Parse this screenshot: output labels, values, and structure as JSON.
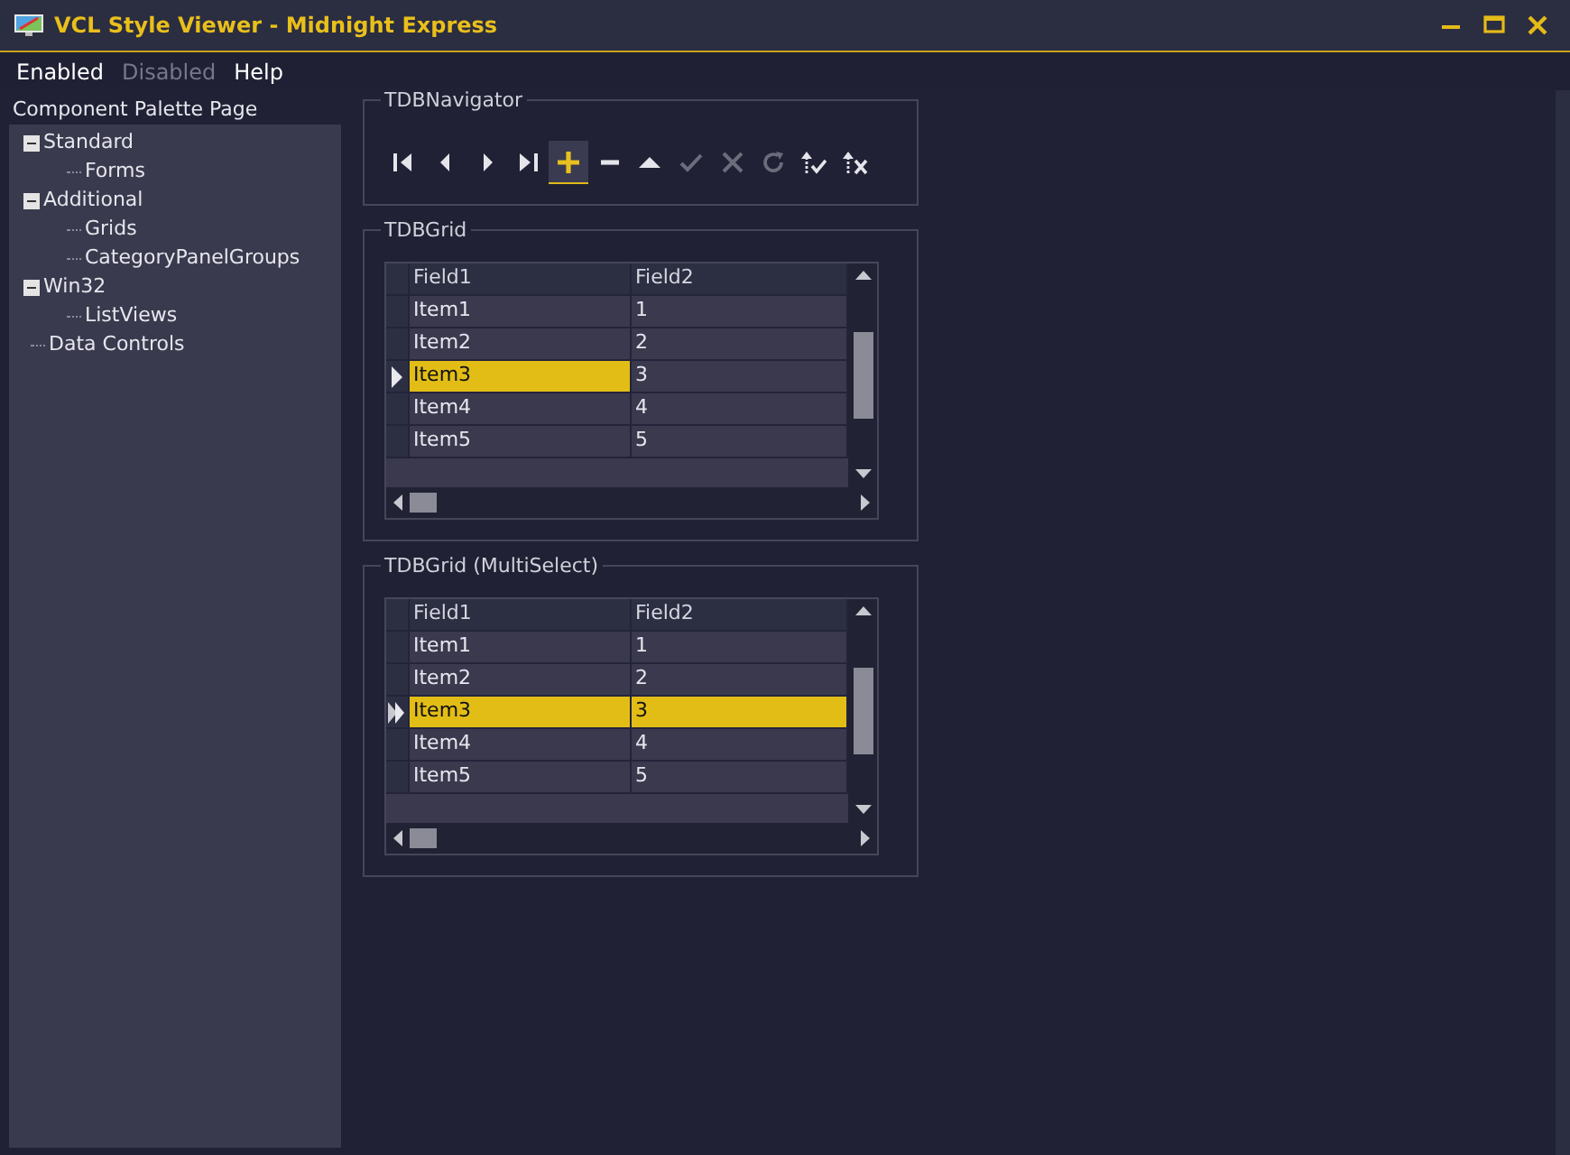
{
  "window": {
    "title": "VCL Style Viewer - Midnight Express"
  },
  "menu": [
    {
      "label": "Enabled",
      "disabled": false
    },
    {
      "label": "Disabled",
      "disabled": true
    },
    {
      "label": "Help",
      "disabled": false
    }
  ],
  "sidebar": {
    "title": "Component Palette Page",
    "tree": [
      {
        "label": "Standard",
        "expanded": true,
        "children": [
          {
            "label": "Forms"
          }
        ]
      },
      {
        "label": "Additional",
        "expanded": true,
        "children": [
          {
            "label": "Grids"
          },
          {
            "label": "CategoryPanelGroups"
          }
        ]
      },
      {
        "label": "Win32",
        "expanded": true,
        "children": [
          {
            "label": "ListViews"
          }
        ]
      },
      {
        "label": "Data Controls"
      }
    ]
  },
  "navigator": {
    "title": "TDBNavigator",
    "buttons": [
      {
        "kind": "first",
        "disabled": false,
        "focused": false
      },
      {
        "kind": "prior",
        "disabled": false,
        "focused": false
      },
      {
        "kind": "next",
        "disabled": false,
        "focused": false
      },
      {
        "kind": "last",
        "disabled": false,
        "focused": false
      },
      {
        "kind": "insert",
        "disabled": false,
        "focused": true
      },
      {
        "kind": "delete",
        "disabled": false,
        "focused": false
      },
      {
        "kind": "edit",
        "disabled": false,
        "focused": false
      },
      {
        "kind": "post",
        "disabled": true,
        "focused": false
      },
      {
        "kind": "cancel",
        "disabled": true,
        "focused": false
      },
      {
        "kind": "refresh",
        "disabled": true,
        "focused": false
      },
      {
        "kind": "apply",
        "disabled": false,
        "focused": false
      },
      {
        "kind": "cancelupdates",
        "disabled": false,
        "focused": false
      }
    ]
  },
  "grids": [
    {
      "title": "TDBGrid",
      "multiselect": false,
      "columns": [
        "Field1",
        "Field2"
      ],
      "rows": [
        {
          "cells": [
            "Item1",
            "1"
          ],
          "selected": false
        },
        {
          "cells": [
            "Item2",
            "2"
          ],
          "selected": false
        },
        {
          "cells": [
            "Item3",
            "3"
          ],
          "selected": true
        },
        {
          "cells": [
            "Item4",
            "4"
          ],
          "selected": false
        },
        {
          "cells": [
            "Item5",
            "5"
          ],
          "selected": false
        }
      ]
    },
    {
      "title": "TDBGrid (MultiSelect)",
      "multiselect": true,
      "columns": [
        "Field1",
        "Field2"
      ],
      "rows": [
        {
          "cells": [
            "Item1",
            "1"
          ],
          "selected": false
        },
        {
          "cells": [
            "Item2",
            "2"
          ],
          "selected": false
        },
        {
          "cells": [
            "Item3",
            "3"
          ],
          "selected": true
        },
        {
          "cells": [
            "Item4",
            "4"
          ],
          "selected": false
        },
        {
          "cells": [
            "Item5",
            "5"
          ],
          "selected": false
        }
      ]
    }
  ]
}
